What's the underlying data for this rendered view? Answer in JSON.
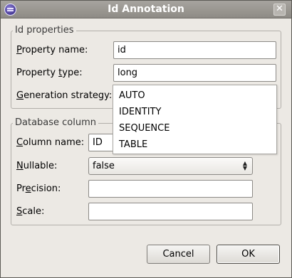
{
  "window": {
    "title": "Id Annotation"
  },
  "id_properties": {
    "legend": "Id properties",
    "property_name": {
      "label_mnemonic": "P",
      "label_rest": "roperty name:",
      "value": "id"
    },
    "property_type": {
      "label_before": "Property ",
      "label_mnemonic": "t",
      "label_rest": "ype:",
      "value": "long"
    },
    "generation_strategy": {
      "label_mnemonic": "G",
      "label_rest": "eneration strategy:",
      "options": [
        "AUTO",
        "IDENTITY",
        "SEQUENCE",
        "TABLE"
      ]
    }
  },
  "database_column": {
    "legend": "Database column",
    "column_name": {
      "label_mnemonic": "C",
      "label_rest": "olumn name:",
      "value": "ID"
    },
    "nullable": {
      "label_mnemonic": "N",
      "label_rest": "ullable:",
      "value": "false"
    },
    "precision": {
      "label_before": "Pr",
      "label_mnemonic": "e",
      "label_rest": "cision:",
      "value": ""
    },
    "scale": {
      "label_mnemonic": "S",
      "label_rest": "cale:",
      "value": ""
    }
  },
  "buttons": {
    "cancel": "Cancel",
    "ok": "OK"
  },
  "icons": {
    "app": "eclipse-icon",
    "close": "close-icon",
    "combo": "updown-arrows-icon"
  }
}
